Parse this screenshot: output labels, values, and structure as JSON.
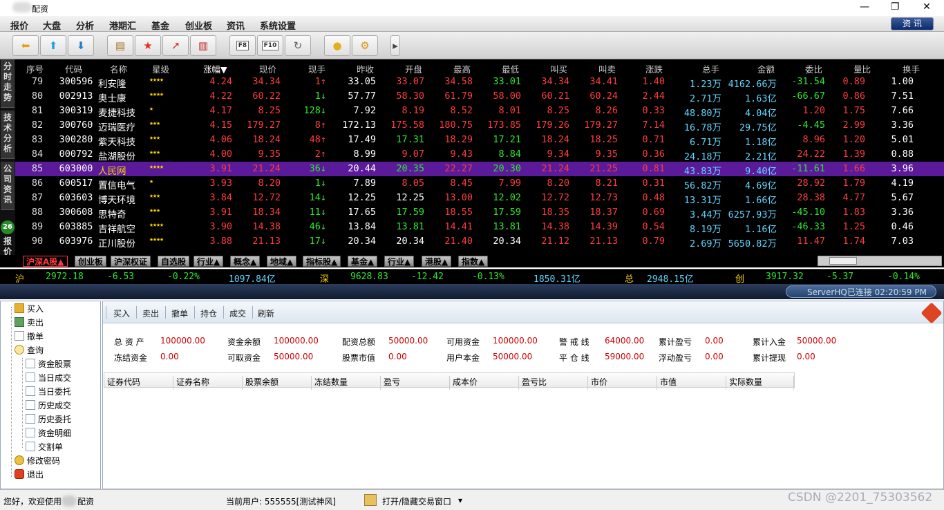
{
  "window": {
    "title": "配资",
    "minimize": "—",
    "restore": "❐",
    "close": "✕"
  },
  "menu": [
    "报价",
    "大盘",
    "分析",
    "港期汇",
    "基金",
    "创业板",
    "资讯",
    "系统设置"
  ],
  "menu_right": "资 讯",
  "toolbar": {
    "buttons": [
      {
        "icon": "arrow-left-icon",
        "glyph": "⬅"
      },
      {
        "icon": "arrow-up-icon",
        "glyph": "⬆"
      },
      {
        "icon": "arrow-down-icon",
        "glyph": "⬇"
      },
      {
        "icon": "notepad-icon",
        "glyph": "▤"
      },
      {
        "icon": "star-icon",
        "glyph": "★"
      },
      {
        "icon": "trend-chart-icon",
        "glyph": "📈"
      },
      {
        "icon": "kline-chart-icon",
        "glyph": "▥"
      },
      {
        "icon": "f8-icon",
        "label": "F8"
      },
      {
        "icon": "f10-icon",
        "label": "F10"
      },
      {
        "icon": "refresh-icon",
        "glyph": "↻"
      },
      {
        "icon": "coin-icon",
        "glyph": "●"
      },
      {
        "icon": "settings-icon",
        "glyph": "⚙"
      }
    ],
    "more": "▸"
  },
  "sidebar": [
    "分时走势",
    "技术分析",
    "公司资讯",
    "26",
    "报价"
  ],
  "columns": [
    "序号",
    "代码",
    "名称",
    "星级",
    "涨幅▼",
    "现价",
    "现手",
    "昨收",
    "开盘",
    "最高",
    "最低",
    "叫买",
    "叫卖",
    "涨跌",
    "总手",
    "金额",
    "委比",
    "量比",
    "换手"
  ],
  "rows": [
    {
      "no": "79",
      "code": "300596",
      "name": "利安隆",
      "stars": "★★★★",
      "chg": "4.24",
      "price": "34.34",
      "vol": "1↑",
      "prev": "33.05",
      "open": "33.07",
      "high": "34.58",
      "low": "33.01",
      "bid": "34.34",
      "ask": "34.41",
      "diff": "1.40",
      "total": "1.23万",
      "amount": "4162.66万",
      "wb": "-31.54",
      "lb": "0.89",
      "hs": "1.00",
      "c_open": "red",
      "c_high": "red",
      "c_low": "grn",
      "c_wb": "grn",
      "c_vol": "red"
    },
    {
      "no": "80",
      "code": "002913",
      "name": "奥士康",
      "stars": "★★★★",
      "chg": "4.22",
      "price": "60.22",
      "vol": "1↓",
      "prev": "57.77",
      "open": "58.30",
      "high": "61.79",
      "low": "58.00",
      "bid": "60.21",
      "ask": "60.24",
      "diff": "2.44",
      "total": "2.71万",
      "amount": "1.63亿",
      "wb": "-66.67",
      "lb": "0.86",
      "hs": "7.51",
      "c_open": "red",
      "c_high": "red",
      "c_low": "red",
      "c_wb": "grn",
      "c_vol": "grn"
    },
    {
      "no": "81",
      "code": "300319",
      "name": "麦捷科技",
      "stars": "★",
      "chg": "4.17",
      "price": "8.25",
      "vol": "128↓",
      "prev": "7.92",
      "open": "8.19",
      "high": "8.52",
      "low": "8.01",
      "bid": "8.25",
      "ask": "8.26",
      "diff": "0.33",
      "total": "48.80万",
      "amount": "4.04亿",
      "wb": "1.20",
      "lb": "1.75",
      "hs": "7.66",
      "c_open": "red",
      "c_high": "red",
      "c_low": "red",
      "c_wb": "red",
      "c_vol": "grn"
    },
    {
      "no": "82",
      "code": "300760",
      "name": "迈瑞医疗",
      "stars": "★★★",
      "chg": "4.15",
      "price": "179.27",
      "vol": "8↑",
      "prev": "172.13",
      "open": "175.58",
      "high": "180.75",
      "low": "173.85",
      "bid": "179.26",
      "ask": "179.27",
      "diff": "7.14",
      "total": "16.78万",
      "amount": "29.75亿",
      "wb": "-4.45",
      "lb": "2.99",
      "hs": "3.36",
      "c_open": "red",
      "c_high": "red",
      "c_low": "red",
      "c_wb": "grn",
      "c_vol": "red"
    },
    {
      "no": "83",
      "code": "300280",
      "name": "紫天科技",
      "stars": "★★★",
      "chg": "4.06",
      "price": "18.24",
      "vol": "48↑",
      "prev": "17.49",
      "open": "17.31",
      "high": "18.29",
      "low": "17.21",
      "bid": "18.24",
      "ask": "18.25",
      "diff": "0.71",
      "total": "6.71万",
      "amount": "1.18亿",
      "wb": "8.96",
      "lb": "1.20",
      "hs": "5.01",
      "c_open": "grn",
      "c_high": "red",
      "c_low": "grn",
      "c_wb": "red",
      "c_vol": "red"
    },
    {
      "no": "84",
      "code": "000792",
      "name": "盐湖股份",
      "stars": "★★★",
      "chg": "4.00",
      "price": "9.35",
      "vol": "2↑",
      "prev": "8.99",
      "open": "9.07",
      "high": "9.43",
      "low": "8.84",
      "bid": "9.34",
      "ask": "9.35",
      "diff": "0.36",
      "total": "24.18万",
      "amount": "2.21亿",
      "wb": "24.22",
      "lb": "1.39",
      "hs": "0.88",
      "c_open": "red",
      "c_high": "red",
      "c_low": "grn",
      "c_wb": "red",
      "c_vol": "red"
    },
    {
      "no": "85",
      "code": "603000",
      "name": "人民网",
      "stars": "★★★★",
      "chg": "3.91",
      "price": "21.24",
      "vol": "36↓",
      "prev": "20.44",
      "open": "20.35",
      "high": "22.27",
      "low": "20.30",
      "bid": "21.24",
      "ask": "21.25",
      "diff": "0.81",
      "total": "43.83万",
      "amount": "9.40亿",
      "wb": "-11.61",
      "lb": "1.66",
      "hs": "3.96",
      "c_open": "grn",
      "c_high": "red",
      "c_low": "grn",
      "c_wb": "grn",
      "c_vol": "grn",
      "selected": true
    },
    {
      "no": "86",
      "code": "600517",
      "name": "置信电气",
      "stars": "★",
      "chg": "3.93",
      "price": "8.20",
      "vol": "1↓",
      "prev": "7.89",
      "open": "8.05",
      "high": "8.45",
      "low": "7.99",
      "bid": "8.20",
      "ask": "8.21",
      "diff": "0.31",
      "total": "56.82万",
      "amount": "4.69亿",
      "wb": "28.92",
      "lb": "1.79",
      "hs": "4.19",
      "c_open": "red",
      "c_high": "red",
      "c_low": "red",
      "c_wb": "red",
      "c_vol": "grn"
    },
    {
      "no": "87",
      "code": "603603",
      "name": "博天环境",
      "stars": "★★★",
      "chg": "3.84",
      "price": "12.72",
      "vol": "14↓",
      "prev": "12.25",
      "open": "12.25",
      "high": "13.00",
      "low": "12.02",
      "bid": "12.72",
      "ask": "12.73",
      "diff": "0.48",
      "total": "13.31万",
      "amount": "1.66亿",
      "wb": "28.38",
      "lb": "4.77",
      "hs": "5.67",
      "c_open": "wht",
      "c_high": "red",
      "c_low": "grn",
      "c_wb": "red",
      "c_vol": "grn"
    },
    {
      "no": "88",
      "code": "300608",
      "name": "思特奇",
      "stars": "★★★",
      "chg": "3.91",
      "price": "18.34",
      "vol": "11↓",
      "prev": "17.65",
      "open": "17.59",
      "high": "18.55",
      "low": "17.59",
      "bid": "18.35",
      "ask": "18.37",
      "diff": "0.69",
      "total": "3.44万",
      "amount": "6257.93万",
      "wb": "-45.10",
      "lb": "1.83",
      "hs": "3.36",
      "c_open": "grn",
      "c_high": "red",
      "c_low": "grn",
      "c_wb": "grn",
      "c_vol": "grn"
    },
    {
      "no": "89",
      "code": "603885",
      "name": "吉祥航空",
      "stars": "★★★★",
      "chg": "3.90",
      "price": "14.38",
      "vol": "46↓",
      "prev": "13.84",
      "open": "13.81",
      "high": "14.41",
      "low": "13.81",
      "bid": "14.38",
      "ask": "14.39",
      "diff": "0.54",
      "total": "8.19万",
      "amount": "1.16亿",
      "wb": "-46.33",
      "lb": "1.25",
      "hs": "0.46",
      "c_open": "grn",
      "c_high": "red",
      "c_low": "grn",
      "c_wb": "grn",
      "c_vol": "grn"
    },
    {
      "no": "90",
      "code": "603976",
      "name": "正川股份",
      "stars": "★★★★",
      "chg": "3.88",
      "price": "21.13",
      "vol": "17↓",
      "prev": "20.34",
      "open": "20.34",
      "high": "21.40",
      "low": "20.34",
      "bid": "21.12",
      "ask": "21.13",
      "diff": "0.79",
      "total": "2.69万",
      "amount": "5650.82万",
      "wb": "11.47",
      "lb": "1.74",
      "hs": "7.03",
      "c_open": "wht",
      "c_high": "red",
      "c_low": "wht",
      "c_wb": "red",
      "c_vol": "grn"
    }
  ],
  "tabs": [
    "沪深A股▲",
    "创业板",
    "沪深权证",
    "自选股",
    "行业▲",
    "概念▲",
    "地域▲",
    "指标股▲",
    "基金▲",
    "行业▲",
    "港股▲",
    "指数▲"
  ],
  "index": {
    "sh_label": "沪",
    "sh_val": "2972.18",
    "sh_chg": "-6.53",
    "sh_pct": "-0.22%",
    "sh_amt": "1097.84亿",
    "sz_label": "深",
    "sz_val": "9628.83",
    "sz_chg": "-12.42",
    "sz_pct": "-0.13%",
    "sz_amt": "1850.31亿",
    "tot_label": "总",
    "tot_amt": "2948.15亿",
    "cy_label": "创",
    "cy_val": "3917.32",
    "cy_chg": "-5.37",
    "cy_pct": "-0.14%"
  },
  "server": "ServerHQ已连接 02:20:59 PM",
  "tree": [
    {
      "label": "买入",
      "icon": "buy"
    },
    {
      "label": "卖出",
      "icon": "sell"
    },
    {
      "label": "撤单",
      "icon": "doc"
    },
    {
      "label": "查询",
      "icon": "srch"
    },
    {
      "label": "资金股票",
      "icon": "doc",
      "child": true
    },
    {
      "label": "当日成交",
      "icon": "doc",
      "child": true
    },
    {
      "label": "当日委托",
      "icon": "doc",
      "child": true
    },
    {
      "label": "历史成交",
      "icon": "doc",
      "child": true
    },
    {
      "label": "历史委托",
      "icon": "doc",
      "child": true
    },
    {
      "label": "资金明细",
      "icon": "doc",
      "child": true
    },
    {
      "label": "交割单",
      "icon": "doc",
      "child": true
    },
    {
      "label": "修改密码",
      "icon": "key"
    },
    {
      "label": "退出",
      "icon": "exit"
    }
  ],
  "trade_toolbar": [
    "买入",
    "卖出",
    "撤单",
    "持仓",
    "成交",
    "刷新"
  ],
  "account": [
    {
      "k": "总 资 产",
      "v": "100000.00"
    },
    {
      "k": "资金余额",
      "v": "100000.00"
    },
    {
      "k": "配资总额",
      "v": "50000.00"
    },
    {
      "k": "可用资金",
      "v": "100000.00"
    },
    {
      "k": "警 戒 线",
      "v": "64000.00"
    },
    {
      "k": "累计盈亏",
      "v": "0.00"
    },
    {
      "k": "累计入金",
      "v": "50000.00"
    },
    {
      "k": "冻结资金",
      "v": "0.00"
    },
    {
      "k": "可取资金",
      "v": "50000.00"
    },
    {
      "k": "股票市值",
      "v": "0.00"
    },
    {
      "k": "用户本金",
      "v": "50000.00"
    },
    {
      "k": "平 仓 线",
      "v": "59000.00"
    },
    {
      "k": "浮动盈亏",
      "v": "0.00"
    },
    {
      "k": "累计提现",
      "v": "0.00"
    }
  ],
  "grid_headers": [
    "证券代码",
    "证券名称",
    "股票余额",
    "冻结数量",
    "盈亏",
    "成本价",
    "盈亏比",
    "市价",
    "市值",
    "实际数量"
  ],
  "status": {
    "welcome_a": "您好，欢迎使用",
    "welcome_b": "配资",
    "user": "当前用户: 555555[测试神风]",
    "toggle": "打开/隐藏交易窗口",
    "dropdown": "▾"
  },
  "watermark": "CSDN @2201_75303562"
}
